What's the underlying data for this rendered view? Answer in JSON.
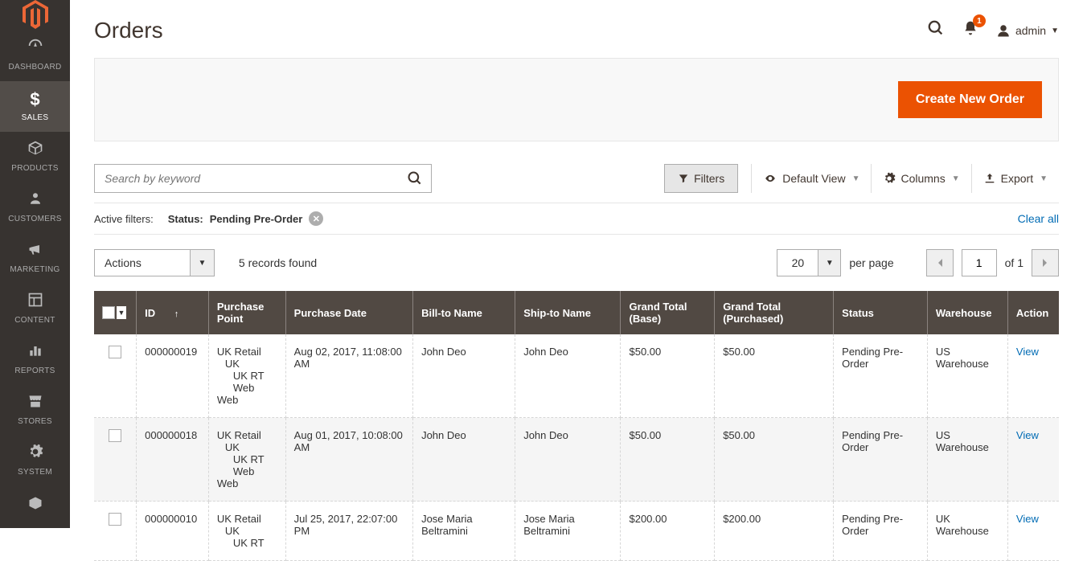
{
  "sidebar": {
    "items": [
      {
        "label": "DASHBOARD"
      },
      {
        "label": "SALES"
      },
      {
        "label": "PRODUCTS"
      },
      {
        "label": "CUSTOMERS"
      },
      {
        "label": "MARKETING"
      },
      {
        "label": "CONTENT"
      },
      {
        "label": "REPORTS"
      },
      {
        "label": "STORES"
      },
      {
        "label": "SYSTEM"
      }
    ]
  },
  "header": {
    "title": "Orders",
    "notifications": "1",
    "admin_label": "admin"
  },
  "action_bar": {
    "create_button": "Create New Order"
  },
  "search": {
    "placeholder": "Search by keyword"
  },
  "toolbar": {
    "filters": "Filters",
    "default_view": "Default View",
    "columns": "Columns",
    "export": "Export"
  },
  "active_filters": {
    "label": "Active filters:",
    "chip_label": "Status:",
    "chip_value": "Pending Pre-Order",
    "clear_all": "Clear all"
  },
  "controls": {
    "actions_label": "Actions",
    "records_found": "5 records found",
    "per_page_value": "20",
    "per_page_label": "per page",
    "page_value": "1",
    "of_label": "of 1"
  },
  "table": {
    "headers": {
      "id": "ID",
      "purchase_point": "Purchase Point",
      "purchase_date": "Purchase Date",
      "bill_to": "Bill-to Name",
      "ship_to": "Ship-to Name",
      "grand_total_base": "Grand Total (Base)",
      "grand_total_purchased": "Grand Total (Purchased)",
      "status": "Status",
      "warehouse": "Warehouse",
      "action": "Action"
    },
    "view_label": "View",
    "rows": [
      {
        "id": "000000019",
        "pp1": "UK Retail",
        "pp2": "UK",
        "pp3": "UK RT Web",
        "date": "Aug 02, 2017, 11:08:00 AM",
        "bill_to": "John Deo",
        "ship_to": "John Deo",
        "gt_base": "$50.00",
        "gt_purchased": "$50.00",
        "status": "Pending Pre-Order",
        "warehouse": "US Warehouse"
      },
      {
        "id": "000000018",
        "pp1": "UK Retail",
        "pp2": "UK",
        "pp3": "UK RT Web",
        "date": "Aug 01, 2017, 10:08:00 AM",
        "bill_to": "John Deo",
        "ship_to": "John Deo",
        "gt_base": "$50.00",
        "gt_purchased": "$50.00",
        "status": "Pending Pre-Order",
        "warehouse": "US Warehouse"
      },
      {
        "id": "000000010",
        "pp1": "UK Retail",
        "pp2": "UK",
        "pp3": "UK RT",
        "date": "Jul 25, 2017, 22:07:00 PM",
        "bill_to": "Jose Maria Beltramini",
        "ship_to": "Jose Maria Beltramini",
        "gt_base": "$200.00",
        "gt_purchased": "$200.00",
        "status": "Pending Pre-Order",
        "warehouse": "UK Warehouse"
      }
    ]
  }
}
